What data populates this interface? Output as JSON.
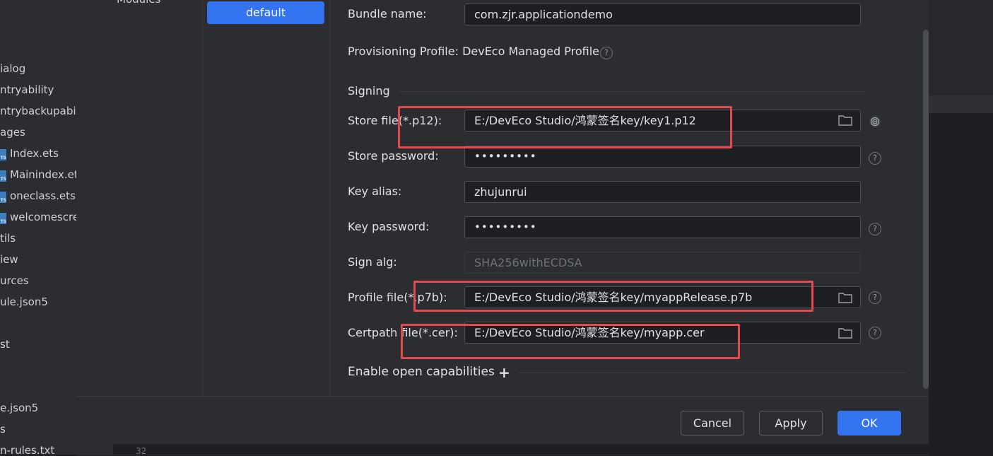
{
  "project_tree": {
    "items": [
      {
        "label": "ialog",
        "ts": false
      },
      {
        "label": "ntryability",
        "ts": false
      },
      {
        "label": "ntrybackupabil",
        "ts": false
      },
      {
        "label": "ages",
        "ts": false
      },
      {
        "label": "Index.ets",
        "ts": true
      },
      {
        "label": "Mainindex.et",
        "ts": true
      },
      {
        "label": "oneclass.ets",
        "ts": true
      },
      {
        "label": "welcomescre",
        "ts": true
      },
      {
        "label": "tils",
        "ts": false
      },
      {
        "label": "iew",
        "ts": false
      },
      {
        "label": "urces",
        "ts": false
      },
      {
        "label": "ule.json5",
        "ts": false
      },
      {
        "label": "st",
        "ts": false
      },
      {
        "label": "e.json5",
        "ts": false
      },
      {
        "label": "s",
        "ts": false
      },
      {
        "label": "n-rules.txt",
        "ts": false
      }
    ]
  },
  "modules": {
    "heading": "Modules",
    "selected_target": "default"
  },
  "form": {
    "bundle_name": {
      "label": "Bundle name:",
      "value": "com.zjr.applicationdemo"
    },
    "provisioning": {
      "label": "Provisioning Profile: DevEco Managed Profile"
    },
    "signing": {
      "heading": "Signing"
    },
    "store_file": {
      "label": "Store file(*.p12):",
      "value": "E:/DevEco Studio/鸿蒙签名key/key1.p12"
    },
    "store_password": {
      "label": "Store password:",
      "value": "•••••••••"
    },
    "key_alias": {
      "label": "Key alias:",
      "value": "zhujunrui"
    },
    "key_password": {
      "label": "Key password:",
      "value": "•••••••••"
    },
    "sign_alg": {
      "label": "Sign alg:",
      "value": "SHA256withECDSA"
    },
    "profile_file": {
      "label": "Profile file(*.p7b):",
      "value": "E:/DevEco Studio/鸿蒙签名key/myappRelease.p7b"
    },
    "certpath_file": {
      "label": "Certpath file(*.cer):",
      "value": "E:/DevEco Studio/鸿蒙签名key/myapp.cer"
    },
    "open_capabilities": {
      "label": "Enable open capabilities",
      "icon": "+"
    }
  },
  "footer": {
    "cancel": "Cancel",
    "apply": "Apply",
    "ok": "OK"
  },
  "editor": {
    "line_number": "32"
  },
  "colors": {
    "accent": "#3574f0",
    "annotation": "#e5484d",
    "background": "#2b2d30"
  }
}
